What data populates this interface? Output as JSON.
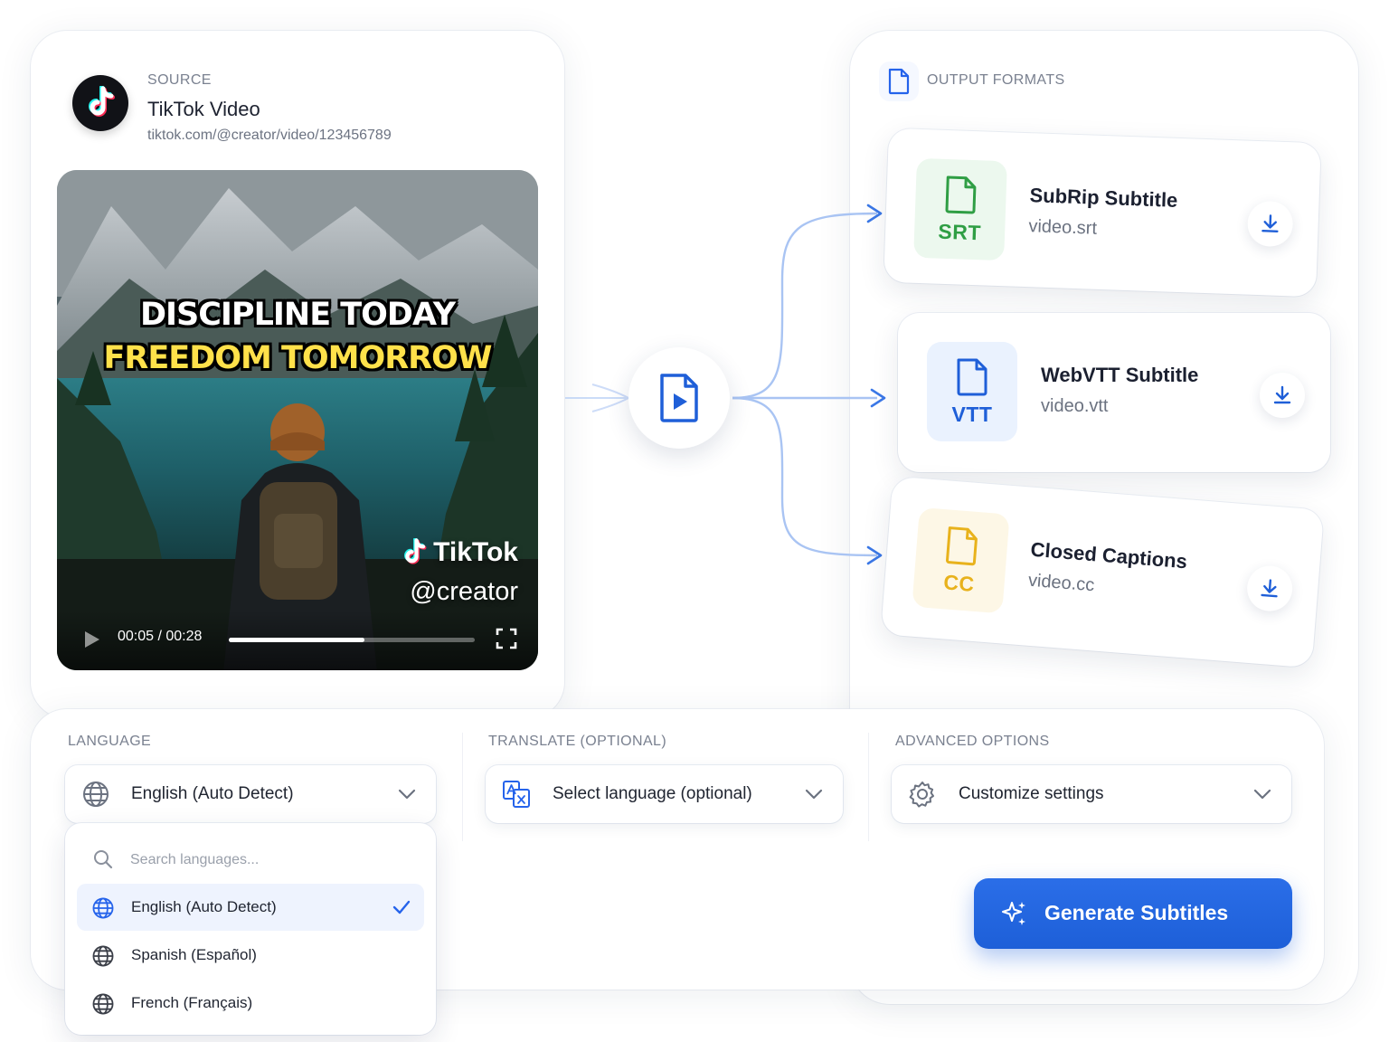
{
  "source": {
    "eyebrow": "SOURCE",
    "title": "TikTok Video",
    "url": "tiktok.com/@creator/video/123456789"
  },
  "video": {
    "headline_line1": "DISCIPLINE TODAY",
    "headline_line2": "FREEDOM TOMORROW",
    "brand": "TikTok",
    "handle": "@creator",
    "time": "00:05 / 00:28",
    "progress": 0.55
  },
  "output": {
    "eyebrow": "OUTPUT FORMATS",
    "formats": [
      {
        "badge": "SRT",
        "title": "SubRip Subtitle",
        "file": "video.srt",
        "color": "#2f9e44",
        "bg": "#ecf8ee"
      },
      {
        "badge": "VTT",
        "title": "WebVTT Subtitle",
        "file": "video.vtt",
        "color": "#1f5fd8",
        "bg": "#eaf2fe"
      },
      {
        "badge": "CC",
        "title": "Closed Captions",
        "file": "video.cc",
        "color": "#e8b21c",
        "bg": "#fdf7e6"
      }
    ]
  },
  "options": {
    "language": {
      "eyebrow": "LANGUAGE",
      "value": "English (Auto Detect)",
      "dropdown": {
        "search_placeholder": "Search languages...",
        "items": [
          {
            "label": "English (Auto Detect)",
            "selected": true
          },
          {
            "label": "Spanish (Español)",
            "selected": false
          },
          {
            "label": "French (Français)",
            "selected": false
          }
        ]
      }
    },
    "translate": {
      "eyebrow": "TRANSLATE (OPTIONAL)",
      "value": "Select language (optional)"
    },
    "advanced": {
      "eyebrow": "ADVANCED OPTIONS",
      "value": "Customize settings"
    }
  },
  "generate": {
    "label": "Generate Subtitles"
  },
  "colors": {
    "accent": "#1f5fd8",
    "connector": "#a9c4f3"
  }
}
